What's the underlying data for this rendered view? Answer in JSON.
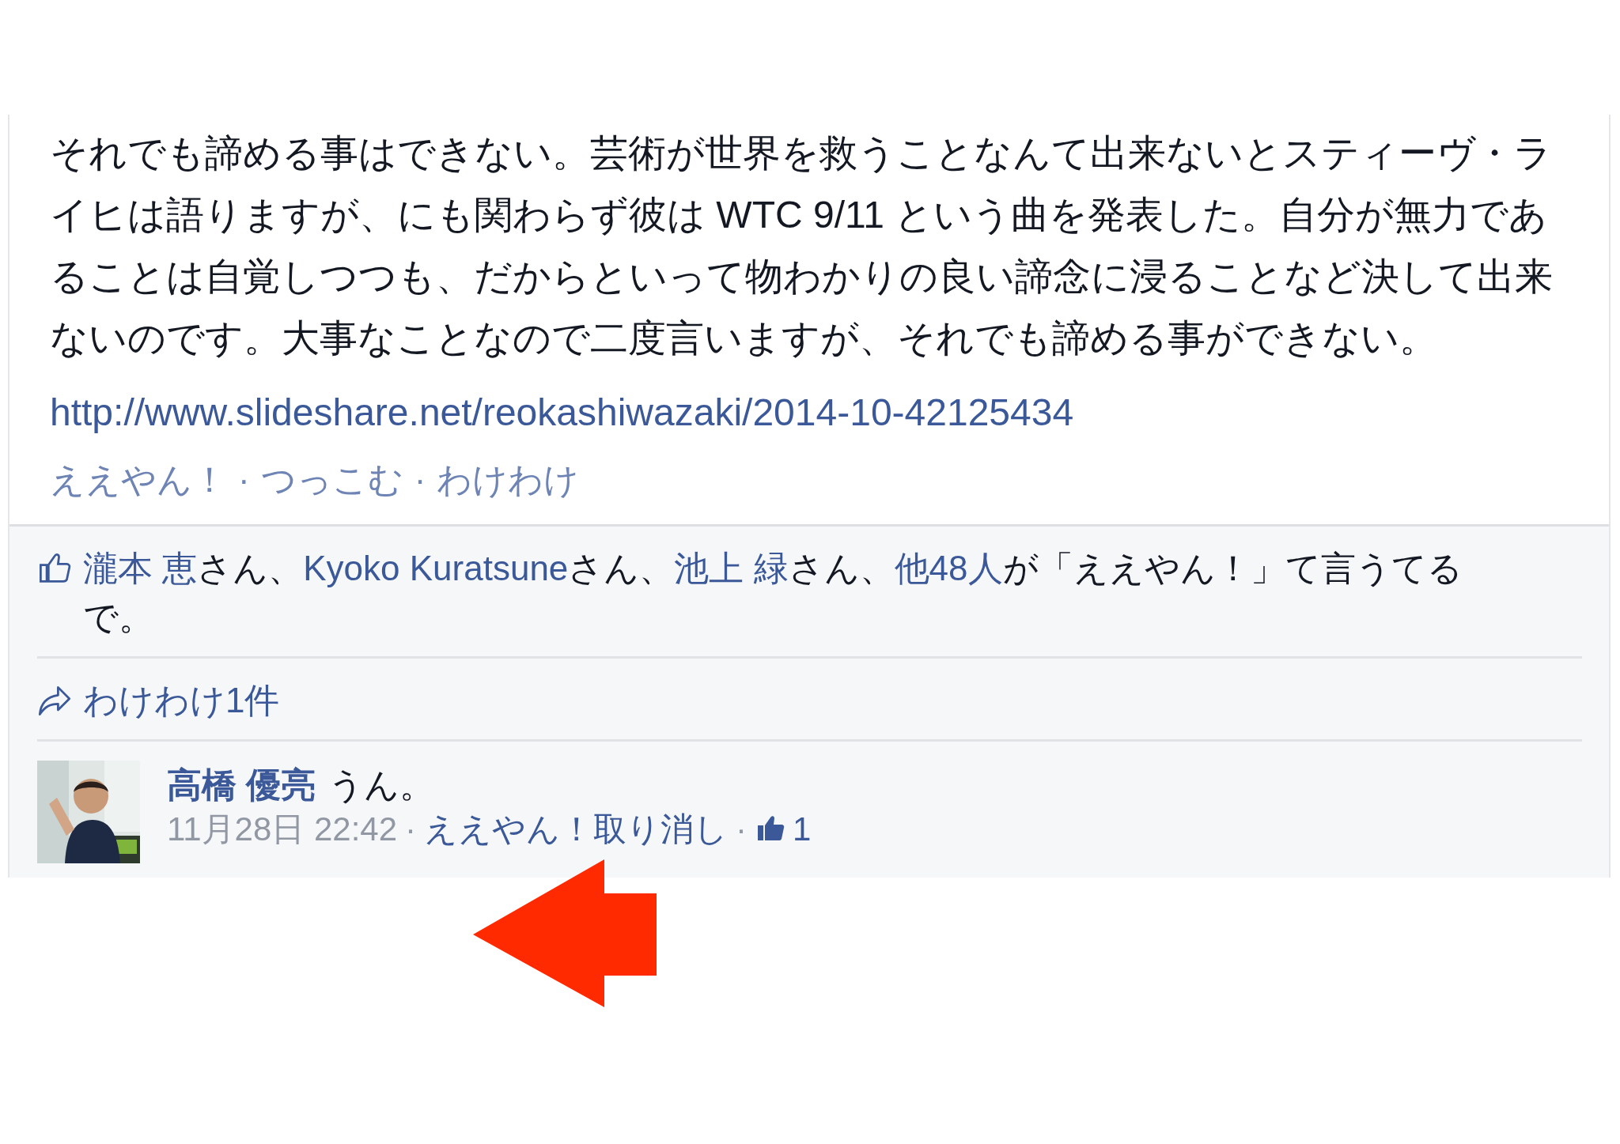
{
  "post": {
    "text": "それでも諦める事はできない。芸術が世界を救うことなんて出来ないとスティーヴ・ライヒは語りますが、にも関わらず彼は WTC 9/11 という曲を発表した。自分が無力であることは自覚しつつも、だからといって物わかりの良い諦念に浸ることなど決して出来ないのです。大事なことなので二度言いますが、それでも諦める事ができない。",
    "link": "http://www.slideshare.net/reokashiwazaki/2014-10-42125434",
    "separator": "·",
    "actions": [
      "ええやん！",
      "つっこむ",
      "わけわけ"
    ]
  },
  "likes": {
    "segments": [
      {
        "kind": "link",
        "text": "瀧本 恵"
      },
      {
        "kind": "plain",
        "text": "さん、"
      },
      {
        "kind": "link",
        "text": "Kyoko Kuratsune"
      },
      {
        "kind": "plain",
        "text": "さん、"
      },
      {
        "kind": "link",
        "text": "池上 緑"
      },
      {
        "kind": "plain",
        "text": "さん、"
      },
      {
        "kind": "link",
        "text": "他48人"
      },
      {
        "kind": "plain",
        "text": "が「ええやん！」て言うてるで。"
      }
    ]
  },
  "shares": {
    "text": "わけわけ1件"
  },
  "comments": [
    {
      "author": "高橋 優亮",
      "text": "うん。",
      "time": "11月28日 22:42",
      "separator": "·",
      "actions": [
        "ええやん！取り消し"
      ],
      "like_count": "1"
    }
  ],
  "annotation": {
    "kind": "arrow",
    "color": "#ff2a00"
  }
}
